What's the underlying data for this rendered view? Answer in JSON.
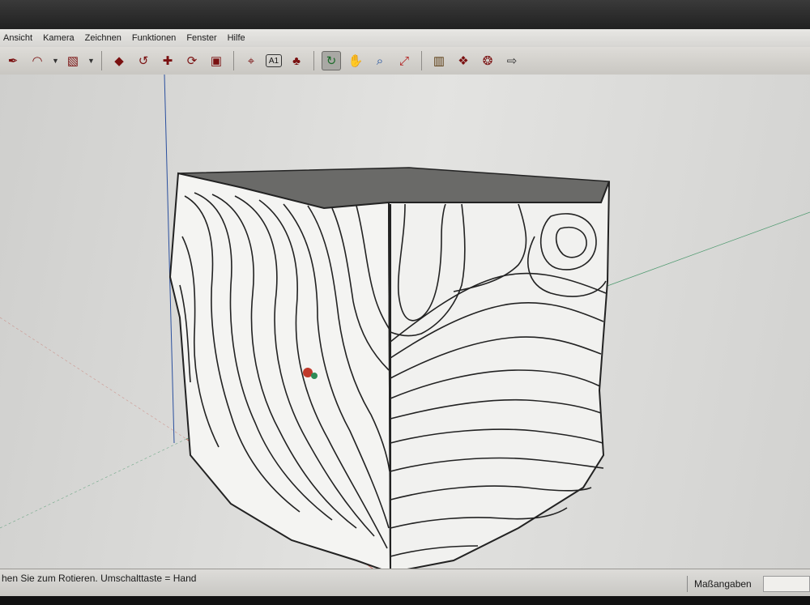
{
  "menu": {
    "items": [
      "Ansicht",
      "Kamera",
      "Zeichnen",
      "Funktionen",
      "Fenster",
      "Hilfe"
    ]
  },
  "toolbar": {
    "tools": [
      {
        "name": "eraser-tool",
        "glyph": "✒"
      },
      {
        "name": "arc-tool",
        "glyph": "◠"
      },
      {
        "name": "paint-bucket-tool",
        "glyph": "▧"
      },
      {
        "name": "push-pull-tool",
        "glyph": "◆"
      },
      {
        "name": "follow-me-tool",
        "glyph": "↺"
      },
      {
        "name": "move-tool",
        "glyph": "✚"
      },
      {
        "name": "rotate-tool",
        "glyph": "⟳"
      },
      {
        "name": "scale-tool",
        "glyph": "▣"
      },
      {
        "name": "tape-measure-tool",
        "glyph": "⌖"
      },
      {
        "name": "text-tool",
        "glyph": "A1"
      },
      {
        "name": "paint-tool",
        "glyph": "♣"
      },
      {
        "name": "orbit-tool",
        "glyph": "↻"
      },
      {
        "name": "pan-tool",
        "glyph": "✋"
      },
      {
        "name": "zoom-tool",
        "glyph": "⌕"
      },
      {
        "name": "zoom-extents-tool",
        "glyph": "⤢"
      },
      {
        "name": "previous-view-tool",
        "glyph": "▥"
      },
      {
        "name": "next-view-tool",
        "glyph": "❖"
      },
      {
        "name": "get-models-tool",
        "glyph": "❂"
      },
      {
        "name": "share-model-tool",
        "glyph": "⇨"
      }
    ]
  },
  "status": {
    "message": "hen Sie zum Rotieren.  Umschalttaste = Hand",
    "measure_label": "Maßangaben",
    "measure_value": ""
  },
  "colors": {
    "axis_red": "#c0392b",
    "axis_green": "#2e8b57",
    "axis_blue": "#2a4f9e",
    "model_face": "#f4f4f2",
    "model_top": "#6a6a68",
    "contour_line": "#222222"
  }
}
